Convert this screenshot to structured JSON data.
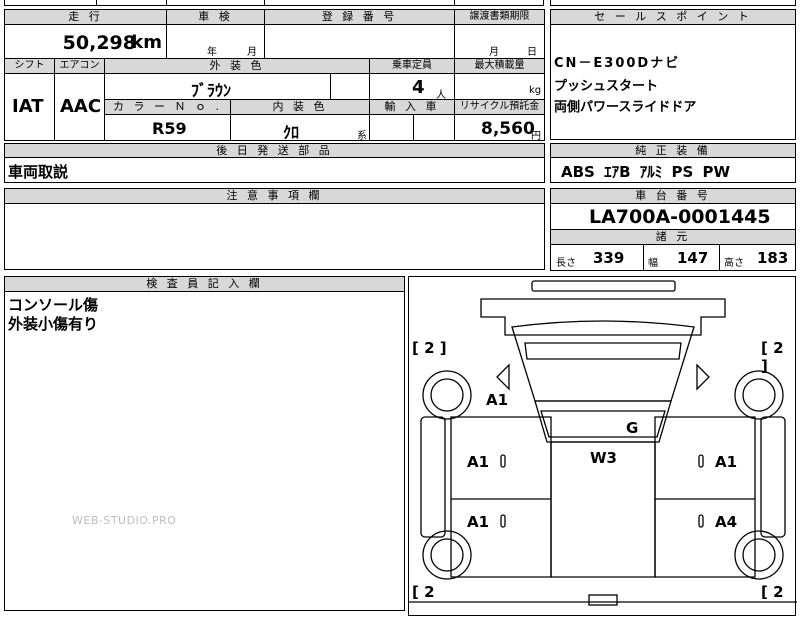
{
  "top_cut": {
    "label_a": "",
    "label_b": ""
  },
  "mileage": {
    "label": "走 行",
    "value": "50,298",
    "unit": "km"
  },
  "inspection": {
    "label": "車 検",
    "year_unit": "年",
    "month_unit": "月"
  },
  "registration": {
    "label": "登 録 番 号",
    "value": ""
  },
  "transfer_deadline": {
    "label": "譲渡書類期限",
    "month_unit": "月",
    "day_unit": "日"
  },
  "sales_points": {
    "label": "セ ー ル ス ポ イ ン ト",
    "lines": [
      "CN－E300Dナビ",
      "プッシュスタート",
      "両側パワースライドドア"
    ]
  },
  "shift": {
    "label": "シフト",
    "value": "IAT"
  },
  "aircon": {
    "label": "エアコン",
    "value": "AAC"
  },
  "exterior_color": {
    "label": "外 装 色",
    "value": "ﾌﾞﾗｳﾝ"
  },
  "capacity": {
    "label": "乗車定員",
    "value": "4",
    "unit": "人"
  },
  "max_load": {
    "label": "最大積載量",
    "value": "",
    "unit": "kg"
  },
  "color_no": {
    "label": "カ ラ ー Ｎ ｏ .",
    "value": "R59"
  },
  "interior_color": {
    "label": "内 装 色",
    "value": "ｸﾛ",
    "suffix": "系"
  },
  "import": {
    "label": "輸 入 車",
    "value": ""
  },
  "recycle": {
    "label": "リサイクル預託金",
    "value": "8,560",
    "unit": "円"
  },
  "later_parts": {
    "label": "後 日 発 送 部 品",
    "value": "車両取説"
  },
  "standard_equipment": {
    "label": "純 正 装 備",
    "value": "ABS ｴｱB ｱﾙﾐ PS PW"
  },
  "notes": {
    "label": "注 意 事 項 欄",
    "value": ""
  },
  "chassis": {
    "label": "車 台 番 号",
    "value": "LA700A-0001445"
  },
  "specs": {
    "label": "諸 元",
    "length_label": "長さ",
    "length": "339",
    "width_label": "幅",
    "width": "147",
    "height_label": "高さ",
    "height": "183"
  },
  "inspector": {
    "label": "検 査 員 記 入 欄",
    "lines": [
      "コンソール傷",
      "外装小傷有り"
    ]
  },
  "watermark": "WEB-STUDIO.PRO",
  "diagram": {
    "brackets": {
      "top_left": "[ 2 ]",
      "top_right": "[ 2 ]",
      "bottom_left": "[ 2",
      "bottom_right": "[ 2"
    },
    "marks": {
      "hood": "A1",
      "windshield": "G",
      "roof": "W3",
      "left_front_door": "A1",
      "right_front_door": "A1",
      "left_rear_door": "A1",
      "right_rear_door": "A4"
    }
  }
}
